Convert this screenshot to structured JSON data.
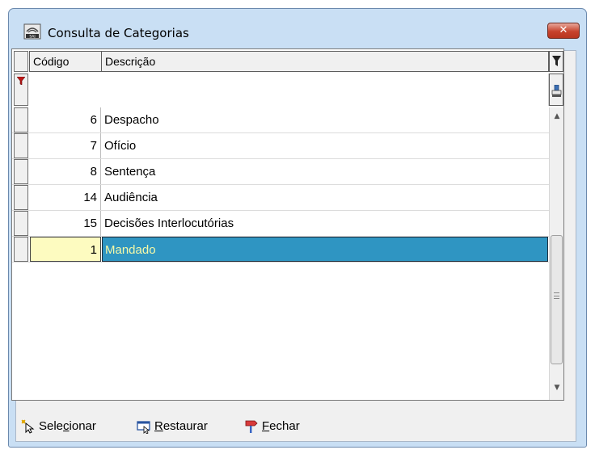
{
  "window": {
    "title": "Consulta de Categorias",
    "close_label": "✕"
  },
  "grid": {
    "columns": [
      "Código",
      "Descrição"
    ],
    "rows": [
      {
        "code": "6",
        "desc": "Despacho"
      },
      {
        "code": "7",
        "desc": "Ofício"
      },
      {
        "code": "8",
        "desc": "Sentença"
      },
      {
        "code": "14",
        "desc": "Audiência"
      },
      {
        "code": "15",
        "desc": "Decisões Interlocutórias"
      },
      {
        "code": "1",
        "desc": "Mandado"
      }
    ],
    "selected_index": 5
  },
  "toolbar": {
    "select_pre": "Sele",
    "select_key": "c",
    "select_post": "ionar",
    "restore_pre": "",
    "restore_key": "R",
    "restore_post": "estaurar",
    "close_pre": "",
    "close_key": "F",
    "close_post": "echar"
  },
  "icons": [
    "app-icon",
    "close-icon",
    "filter-funnel-icon",
    "filter-toggle-icon",
    "clear-filter-icon",
    "select-cursor-icon",
    "restore-icon",
    "close-flag-icon"
  ],
  "colors": {
    "selection_bg": "#2f95c2",
    "selection_text": "#f6f9a8",
    "current_cell": "#fdfbc0",
    "close_button": "#c7432d"
  }
}
